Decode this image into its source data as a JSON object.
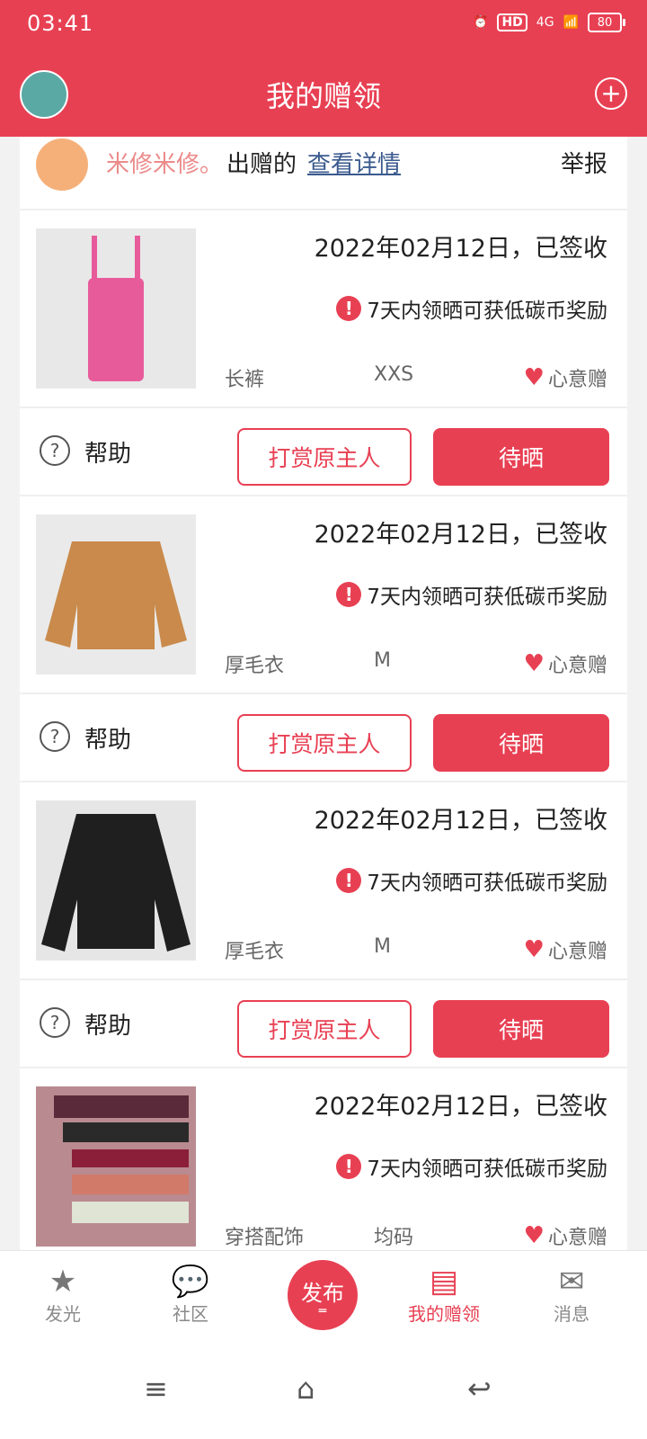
{
  "status_bar": {
    "time": "03:41",
    "network": "4G",
    "hd": "HD",
    "battery": "80"
  },
  "header": {
    "title": "我的赠领",
    "add_icon": "plus-circle-icon",
    "logo_icon": "leaf-logo-icon"
  },
  "giver": {
    "name": "米修米修。",
    "action": "出赠的",
    "link": "查看详情",
    "report": "举报"
  },
  "items": [
    {
      "date": "2022年02月12日，已签收",
      "notice": "7天内领晒可获低碳币奖励",
      "category": "长裤",
      "size": "XXS",
      "gift_label": "心意赠",
      "thumb_color": "#e85b9b"
    },
    {
      "date": "2022年02月12日，已签收",
      "notice": "7天内领晒可获低碳币奖励",
      "category": "厚毛衣",
      "size": "M",
      "gift_label": "心意赠",
      "thumb_color": "#c98a4b"
    },
    {
      "date": "2022年02月12日，已签收",
      "notice": "7天内领晒可获低碳币奖励",
      "category": "厚毛衣",
      "size": "M",
      "gift_label": "心意赠",
      "thumb_color": "#1f1f1f"
    },
    {
      "date": "2022年02月12日，已签收",
      "notice": "7天内领晒可获低碳币奖励",
      "category": "穿搭配饰",
      "size": "均码",
      "gift_label": "心意赠",
      "thumb_color": "#a04a5a"
    }
  ],
  "actions": {
    "help": "帮助",
    "reward": "打赏原主人",
    "pending": "待晒"
  },
  "bottom_nav": [
    {
      "label": "发光",
      "icon": "star-icon"
    },
    {
      "label": "社区",
      "icon": "chat-bubbles-icon"
    },
    {
      "label": "发布",
      "icon": "publish-icon"
    },
    {
      "label": "我的赠领",
      "icon": "gift-cards-icon"
    },
    {
      "label": "消息",
      "icon": "envelope-icon"
    }
  ],
  "colors": {
    "brand": "#e84053",
    "link": "#3b5a8e",
    "giver_name": "#ec8a8a"
  }
}
